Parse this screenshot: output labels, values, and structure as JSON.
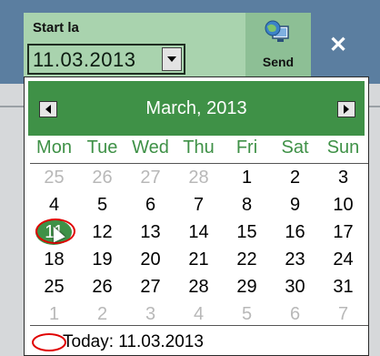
{
  "toolbar": {
    "start_label": "Start la",
    "date_value": "11.03.2013",
    "send_label": "Send",
    "close_glyph": "✕",
    "send_icon": "globe-monitor-icon",
    "colors": {
      "toolbar_bg": "#5b7ea0",
      "start_panel_bg": "#a9d3ae",
      "send_panel_bg": "#8dbf95"
    }
  },
  "calendar": {
    "month_title": "March, 2013",
    "weekdays": [
      "Mon",
      "Tue",
      "Wed",
      "Thu",
      "Fri",
      "Sat",
      "Sun"
    ],
    "selected_day": "11",
    "weeks": [
      [
        {
          "d": "25",
          "o": true
        },
        {
          "d": "26",
          "o": true
        },
        {
          "d": "27",
          "o": true
        },
        {
          "d": "28",
          "o": true
        },
        {
          "d": "1",
          "o": false
        },
        {
          "d": "2",
          "o": false
        },
        {
          "d": "3",
          "o": false
        }
      ],
      [
        {
          "d": "4",
          "o": false
        },
        {
          "d": "5",
          "o": false
        },
        {
          "d": "6",
          "o": false
        },
        {
          "d": "7",
          "o": false
        },
        {
          "d": "8",
          "o": false
        },
        {
          "d": "9",
          "o": false
        },
        {
          "d": "10",
          "o": false
        }
      ],
      [
        {
          "d": "11",
          "o": false,
          "s": true
        },
        {
          "d": "12",
          "o": false
        },
        {
          "d": "13",
          "o": false
        },
        {
          "d": "14",
          "o": false
        },
        {
          "d": "15",
          "o": false
        },
        {
          "d": "16",
          "o": false
        },
        {
          "d": "17",
          "o": false
        }
      ],
      [
        {
          "d": "18",
          "o": false
        },
        {
          "d": "19",
          "o": false
        },
        {
          "d": "20",
          "o": false
        },
        {
          "d": "21",
          "o": false
        },
        {
          "d": "22",
          "o": false
        },
        {
          "d": "23",
          "o": false
        },
        {
          "d": "24",
          "o": false
        }
      ],
      [
        {
          "d": "25",
          "o": false
        },
        {
          "d": "26",
          "o": false
        },
        {
          "d": "27",
          "o": false
        },
        {
          "d": "28",
          "o": false
        },
        {
          "d": "29",
          "o": false
        },
        {
          "d": "30",
          "o": false
        },
        {
          "d": "31",
          "o": false
        }
      ],
      [
        {
          "d": "1",
          "o": true
        },
        {
          "d": "2",
          "o": true
        },
        {
          "d": "3",
          "o": true
        },
        {
          "d": "4",
          "o": true
        },
        {
          "d": "5",
          "o": true
        },
        {
          "d": "6",
          "o": true
        },
        {
          "d": "7",
          "o": true
        }
      ]
    ],
    "today_text": "Today: 11.03.2013",
    "colors": {
      "header_bg": "#3f9147",
      "weekday_text": "#3f9147",
      "other_month_text": "#b8b8b8",
      "highlight_oval": "#e00000"
    }
  }
}
